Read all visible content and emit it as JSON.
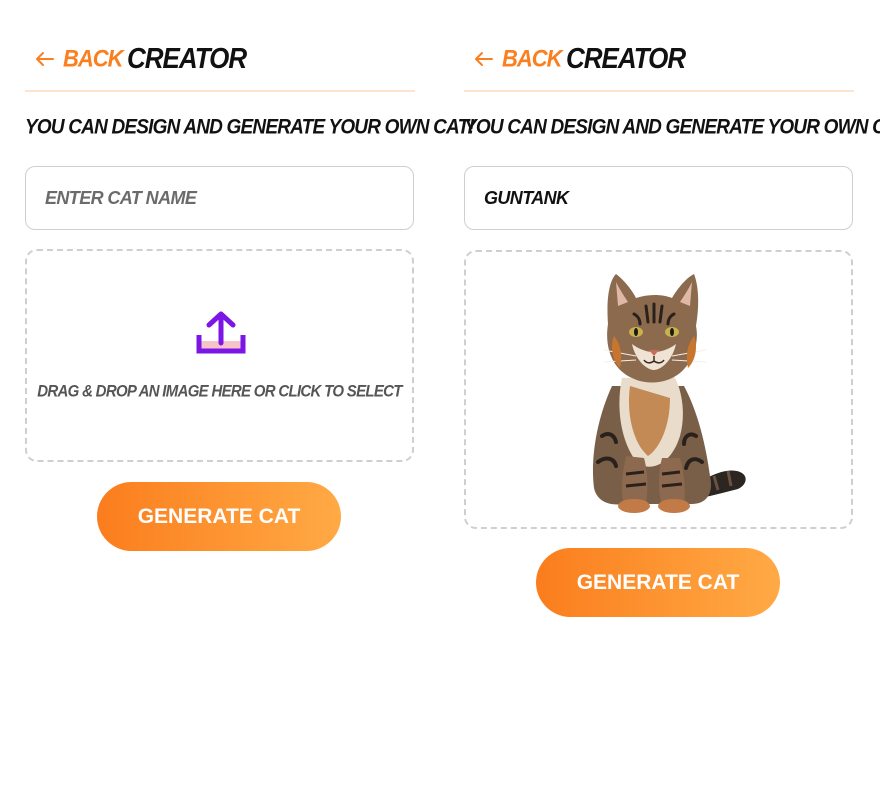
{
  "left_screen": {
    "back_label": "BACK",
    "title": "CREATOR",
    "subtitle": "YOU CAN DESIGN AND GENERATE YOUR OWN CAT!",
    "name_input": {
      "value": "",
      "placeholder": "ENTER CAT NAME"
    },
    "dropzone": {
      "icon": "upload-icon",
      "text": "DRAG & DROP AN IMAGE HERE OR CLICK TO SELECT"
    },
    "generate_label": "GENERATE CAT"
  },
  "right_screen": {
    "back_label": "BACK",
    "title": "CREATOR",
    "subtitle": "YOU CAN DESIGN AND GENERATE YOUR OWN CAT!",
    "name_input": {
      "value": "GUNTANK",
      "placeholder": "ENTER CAT NAME"
    },
    "dropzone": {
      "image": "tabby-cat-watercolor"
    },
    "generate_label": "GENERATE CAT"
  },
  "colors": {
    "accent_orange": "#fb7f1f",
    "gradient_end": "#ffaa45",
    "upload_icon_purple": "#7b16e6",
    "upload_icon_pink": "#f6c3c9",
    "header_divider": "#fde4cf",
    "border_gray": "#cfcfcf"
  }
}
